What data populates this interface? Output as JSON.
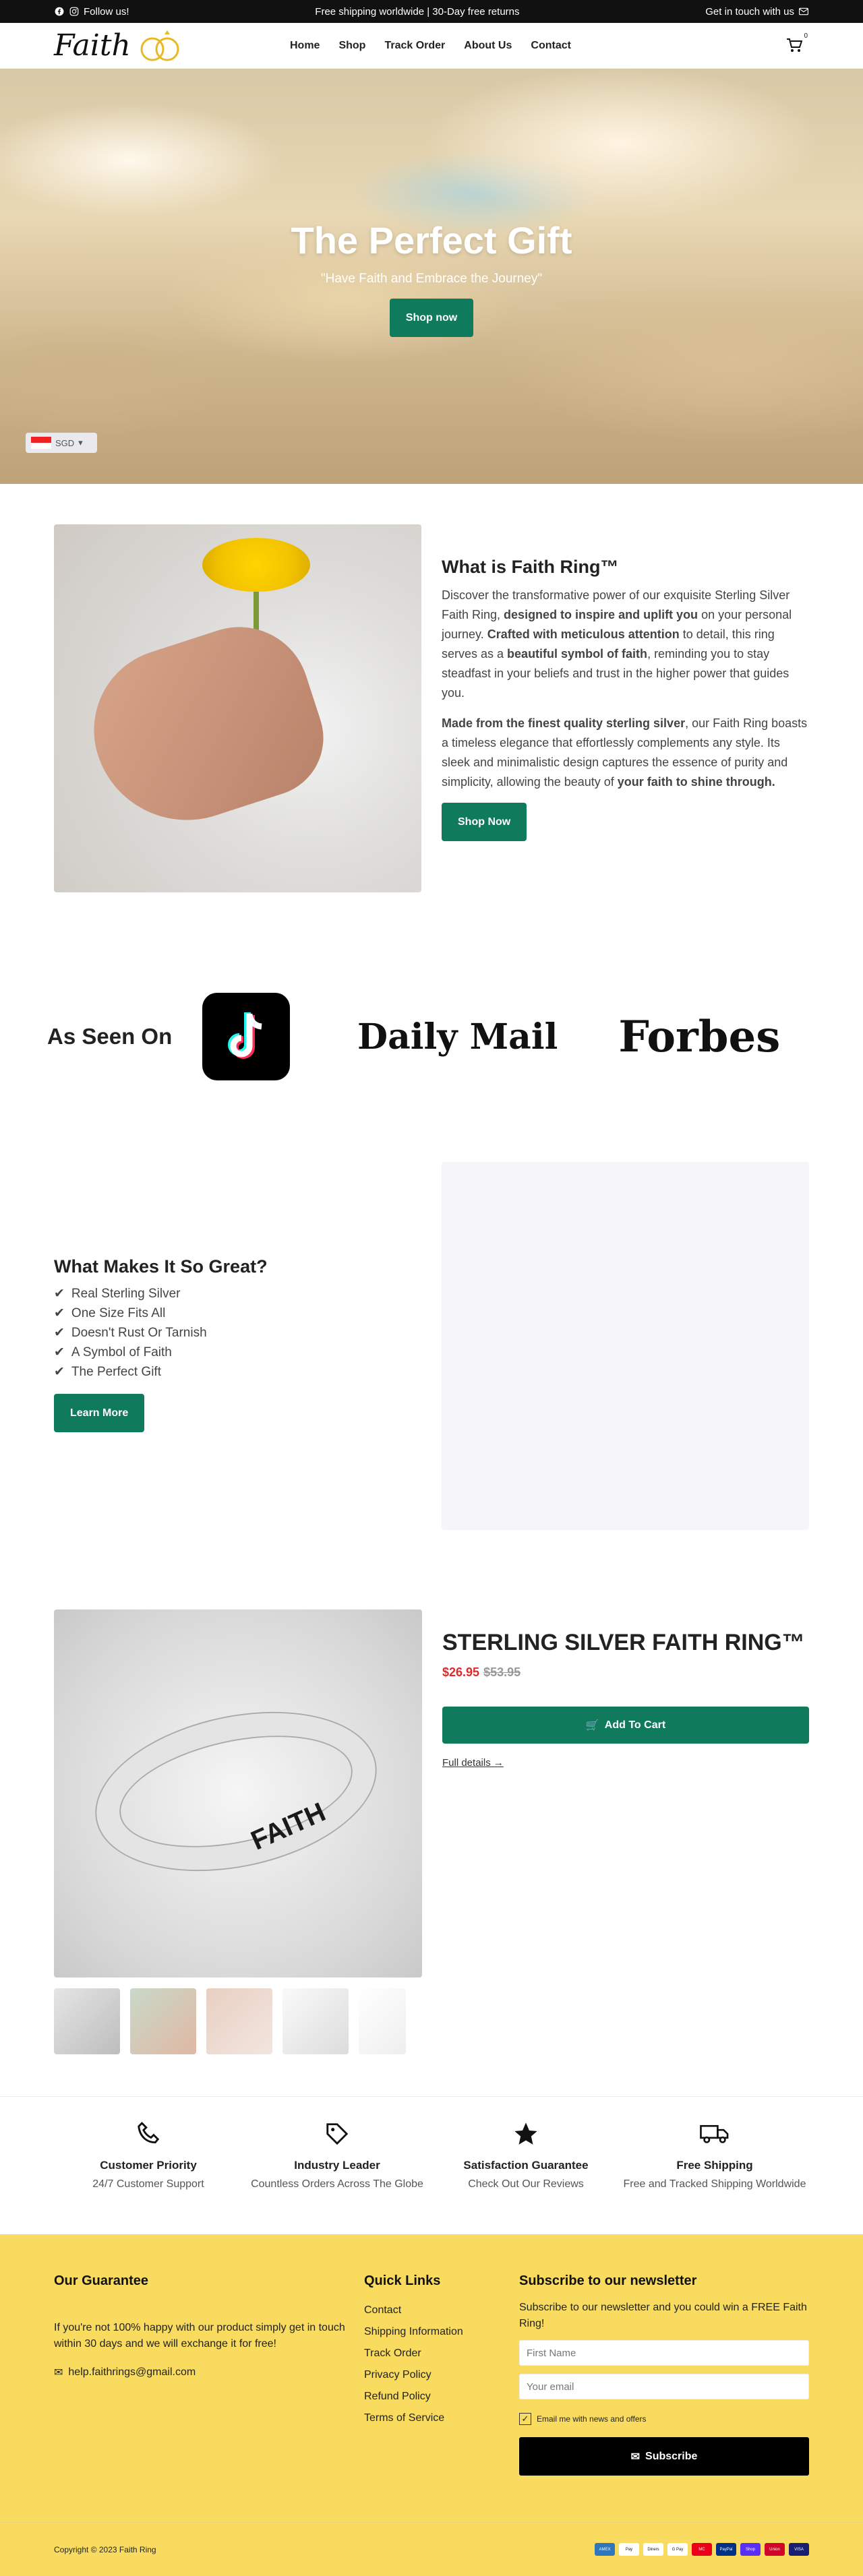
{
  "topbar": {
    "follow": "Follow us!",
    "promo": "Free shipping worldwide | 30-Day free returns",
    "contact": "Get in touch with us"
  },
  "header": {
    "logo": "Faith",
    "nav": [
      "Home",
      "Shop",
      "Track Order",
      "About Us",
      "Contact"
    ],
    "cart_count": "0"
  },
  "hero": {
    "title": "The Perfect Gift",
    "subtitle": "\"Have Faith and Embrace the Journey\"",
    "cta": "Shop now",
    "currency": "SGD"
  },
  "what": {
    "title": "What is Faith Ring™",
    "p1_a": "Discover the transformative power of our exquisite Sterling Silver Faith Ring, ",
    "p1_b": "designed to inspire and uplift you",
    "p1_c": " on your personal journey. ",
    "p1_d": "Crafted with meticulous attention",
    "p1_e": " to detail, this ring serves as a ",
    "p1_f": "beautiful symbol of faith",
    "p1_g": ", reminding you to stay steadfast in your beliefs and trust in the higher power that guides you.",
    "p2_a": "Made from the finest quality sterling silver",
    "p2_b": ", our Faith Ring boasts a timeless elegance that effortlessly complements any style. Its sleek and minimalistic design captures the essence of purity and simplicity, allowing the beauty of ",
    "p2_c": "your faith to shine through.",
    "cta": "Shop Now"
  },
  "seen": {
    "title": "As Seen On",
    "brands": [
      "Daily",
      "Mail",
      "Forbes"
    ]
  },
  "great": {
    "title": "What Makes It So Great?",
    "items": [
      "Real Sterling Silver",
      "One Size Fits All",
      "Doesn't Rust Or Tarnish",
      "A Symbol of Faith",
      "The Perfect Gift"
    ],
    "cta": "Learn More"
  },
  "product": {
    "title": "STERLING SILVER FAITH RING™",
    "price": "$26.95",
    "compare": "$53.95",
    "add": "Add To Cart",
    "details": "Full details →",
    "engraving": "FAITH"
  },
  "features": [
    {
      "title": "Customer Priority",
      "text": "24/7 Customer Support",
      "icon": "phone-icon"
    },
    {
      "title": "Industry Leader",
      "text": "Countless Orders Across The Globe",
      "icon": "tag-icon"
    },
    {
      "title": "Satisfaction Guarantee",
      "text": "Check Out Our Reviews",
      "icon": "star-icon"
    },
    {
      "title": "Free Shipping",
      "text": "Free and Tracked Shipping Worldwide",
      "icon": "truck-icon"
    }
  ],
  "footer": {
    "g_title": "Our Guarantee",
    "g_text": "If you're not 100% happy with our product simply get in touch within 30 days and we will exchange it for free!",
    "email": "help.faithrings@gmail.com",
    "links_title": "Quick Links",
    "links": [
      "Contact",
      "Shipping Information",
      "Track Order",
      "Privacy Policy",
      "Refund Policy",
      "Terms of Service"
    ],
    "news_title": "Subscribe to our newsletter",
    "news_text": "Subscribe to our newsletter and you could win a FREE Faith Ring!",
    "first_ph": "First Name",
    "email_ph": "Your email",
    "optin": "Email me with news and offers",
    "subscribe": "Subscribe",
    "copyright": "Copyright © 2023 Faith Ring",
    "payments": [
      "AMEX",
      "Pay",
      "Diners",
      "G Pay",
      "MC",
      "PayPal",
      "Shop",
      "Union",
      "VISA"
    ]
  },
  "colors": {
    "accent": "#0f7a5c",
    "footer_bg": "#f8db5f",
    "price": "#e02a2a"
  }
}
